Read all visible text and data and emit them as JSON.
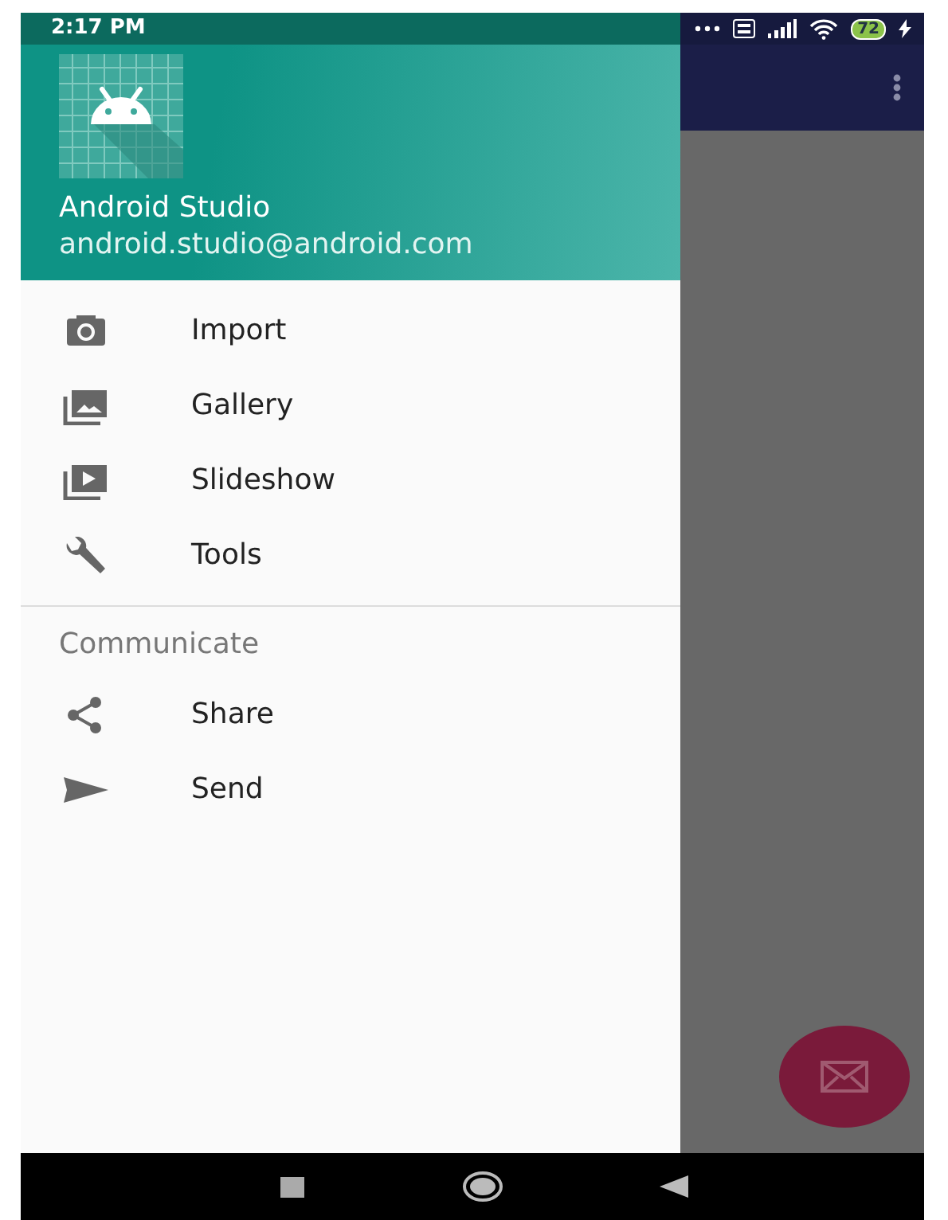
{
  "status_bar": {
    "time": "2:17 PM",
    "battery": "72"
  },
  "drawer": {
    "header": {
      "title": "Android Studio",
      "subtitle": "android.studio@android.com"
    },
    "items": [
      {
        "kind": "camera",
        "label": "Import"
      },
      {
        "kind": "gallery",
        "label": "Gallery"
      },
      {
        "kind": "slideshow",
        "label": "Slideshow"
      },
      {
        "kind": "tools",
        "label": "Tools"
      }
    ],
    "sections": [
      {
        "title": "Communicate",
        "items": [
          {
            "kind": "share",
            "label": "Share"
          },
          {
            "kind": "send",
            "label": "Send"
          }
        ]
      }
    ]
  }
}
